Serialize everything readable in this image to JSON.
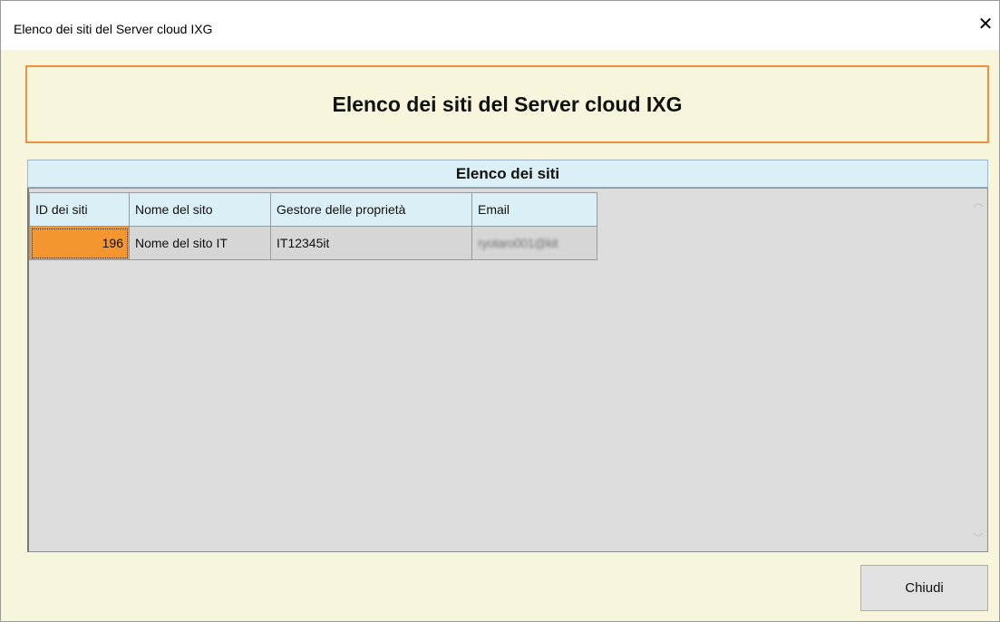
{
  "window": {
    "title": "Elenco dei siti del Server cloud IXG",
    "close_glyph": "✕"
  },
  "header": {
    "title": "Elenco dei siti del Server cloud IXG"
  },
  "section": {
    "title": "Elenco dei siti"
  },
  "table": {
    "columns": [
      "ID dei siti",
      "Nome del sito",
      "Gestore delle proprietà",
      "Email"
    ],
    "rows": [
      {
        "id": "196",
        "name": "Nome del sito IT",
        "owner": "IT12345it",
        "email": "ryotaro001@kit"
      }
    ]
  },
  "scrollbar": {
    "up_glyph": "︿",
    "down_glyph": "﹀"
  },
  "buttons": {
    "close_label": "Chiudi"
  },
  "colors": {
    "background": "#f7f6dc",
    "accent_border": "#f0903b",
    "selected_cell": "#f4962f",
    "header_blue": "#dbeff6"
  }
}
